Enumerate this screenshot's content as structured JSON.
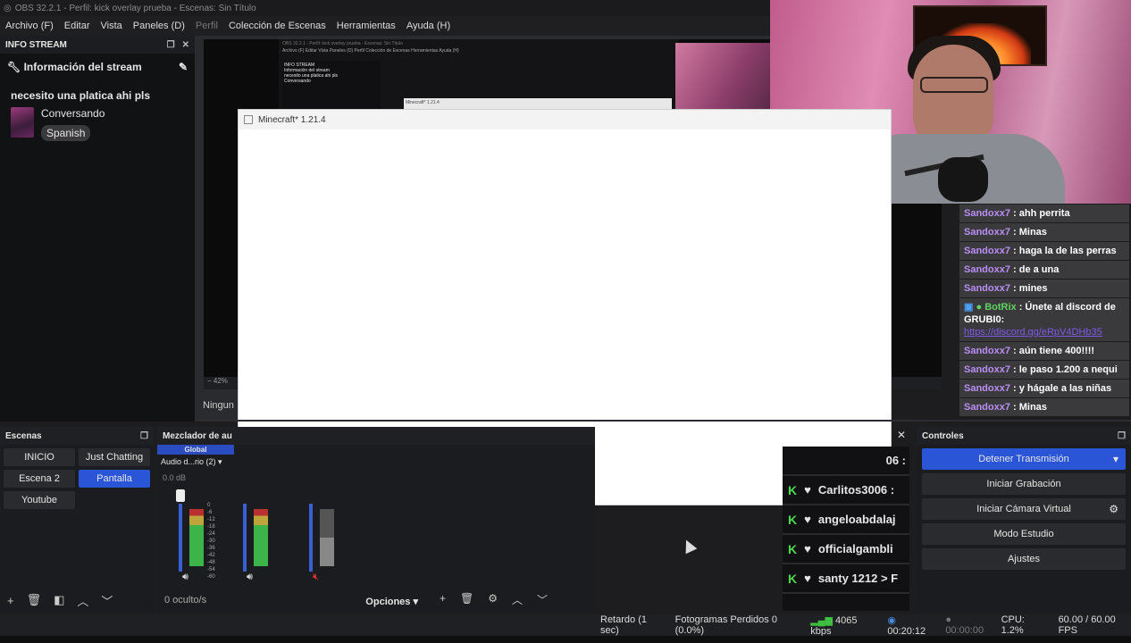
{
  "app": {
    "window_title": "OBS 32.2.1 - Perfil: kick overlay prueba - Escenas: Sin Título",
    "menu": [
      "Archivo (F)",
      "Editar",
      "Vista",
      "Paneles (D)",
      "Perfil",
      "Colección de Escenas",
      "Herramientas",
      "Ayuda (H)"
    ]
  },
  "info_stream": {
    "dock_title": "INFO STREAM",
    "section_title": "Información del stream",
    "stream_title": "necesito una platica ahi pls",
    "category": "Conversando",
    "language": "Spanish"
  },
  "preview": {
    "zoom": "42%",
    "transition_label": "Ningun"
  },
  "nested_preview": {
    "title": "OBS 32.2.1 - Perfil: kick overlay prueba - Escenas: Sin Título",
    "menu": "Archivo (F)  Editar  Vista  Paneles (D)  Perfil  Colección de Escenas  Herramientas  Ayuda (H)",
    "dock_title": "INFO STREAM",
    "section_title": "Información del stream",
    "stream_title": "necesito una platica ahi pls",
    "category": "Conversando",
    "mc_title": "Minecraft* 1.21.4"
  },
  "minecraft_window": {
    "title": "Minecraft* 1.21.4"
  },
  "chat": [
    {
      "user": "Sandoxx7",
      "text": " : ahh perrita"
    },
    {
      "user": "Sandoxx7",
      "text": " : Minas"
    },
    {
      "user": "Sandoxx7",
      "text": " : haga la de las perras"
    },
    {
      "user": "Sandoxx7",
      "text": " : de a una"
    },
    {
      "user": "Sandoxx7",
      "text": " : mines"
    },
    {
      "bot": "BotRix",
      "text": " : Únete al discord de GRUBI0:",
      "link": "https://discord.gg/eRpV4DHb35"
    },
    {
      "user": "Sandoxx7",
      "text": " : aún tiene 400!!!!"
    },
    {
      "user": "Sandoxx7",
      "text": " : le paso 1.200 a nequi"
    },
    {
      "user": "Sandoxx7",
      "text": " : y hágale a las niñas"
    },
    {
      "user": "Sandoxx7",
      "text": " : Minas"
    }
  ],
  "scenes": {
    "title": "Escenas",
    "items": [
      "INICIO",
      "Just Chatting",
      "Escena 2",
      "Pantalla",
      "Youtube"
    ],
    "active": "Pantalla"
  },
  "mixer": {
    "title": "Mezclador de au",
    "global_label": "Global",
    "device": "Audio d...rio (2)",
    "db": "0.0 dB",
    "hidden": "0 oculto/s",
    "options": "Opciones",
    "scale": [
      "0",
      "-6",
      "-12",
      "-18",
      "-24",
      "-30",
      "-36",
      "-42",
      "-48",
      "-54",
      "-60"
    ]
  },
  "kick_events": [
    {
      "name": "06 :"
    },
    {
      "name": "Carlitos3006 :"
    },
    {
      "name": "angeloabdalaj"
    },
    {
      "name": "officialgambli"
    },
    {
      "name": "santy 1212 > F"
    }
  ],
  "controls": {
    "title": "Controles",
    "stop_stream": "Detener Transmisión",
    "start_recording": "Iniciar Grabación",
    "virtual_cam": "Iniciar Cámara Virtual",
    "studio_mode": "Modo Estudio",
    "settings": "Ajustes"
  },
  "status": {
    "delay": "Retardo (1 sec)",
    "dropped": "Fotogramas Perdidos 0 (0.0%)",
    "bitrate": "4065 kbps",
    "stream_time": "00:20:12",
    "rec_time": "00:00:00",
    "cpu": "CPU: 1.2%",
    "fps": "60.00 / 60.00 FPS"
  },
  "colors": {
    "accent": "#2b55d7",
    "chat_user": "#b98ef5",
    "bot": "#5fd35f",
    "kick_green": "#4cdb4c"
  }
}
